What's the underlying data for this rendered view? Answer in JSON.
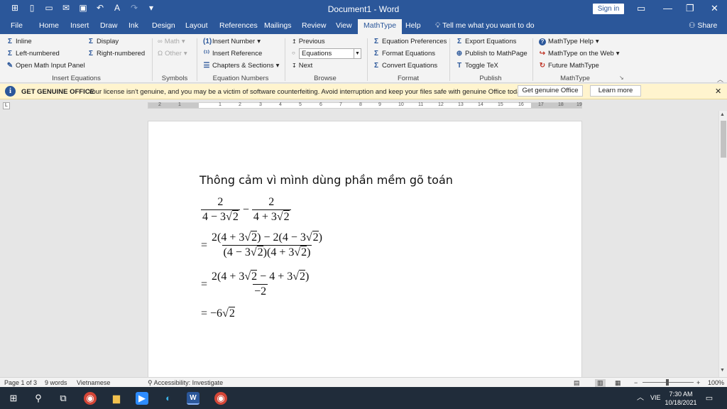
{
  "window": {
    "title": "Document1 - Word",
    "sign_in": "Sign in"
  },
  "icons": {
    "autosave": "autosave-icon",
    "new": "new-document-icon",
    "open": "open-folder-icon",
    "save": "save-icon",
    "undo": "undo-icon",
    "redo": "redo-icon",
    "customize": "customize-qat-icon",
    "ribbon_display": "ribbon-display-icon",
    "minimize": "minimize-icon",
    "restore": "restore-icon",
    "close": "close-icon",
    "tell_me": "lightbulb-icon",
    "share": "person-icon",
    "info": "info-icon"
  },
  "tabs": [
    "File",
    "Home",
    "Insert",
    "Draw",
    "Ink",
    "Design",
    "Layout",
    "References",
    "Mailings",
    "Review",
    "View",
    "MathType",
    "Help"
  ],
  "active_tab": "MathType",
  "tell_me": "Tell me what you want to do",
  "share": "Share",
  "ribbon": {
    "insert_equations": {
      "label": "Insert Equations",
      "inline": "Inline",
      "display": "Display",
      "left_numbered": "Left-numbered",
      "right_numbered": "Right-numbered",
      "open_panel": "Open Math Input Panel"
    },
    "symbols": {
      "label": "Symbols",
      "math": "Math",
      "other": "Other"
    },
    "equation_numbers": {
      "label": "Equation Numbers",
      "insert_number": "Insert Number",
      "insert_reference": "Insert Reference",
      "chapters_sections": "Chapters & Sections"
    },
    "browse": {
      "label": "Browse",
      "previous": "Previous",
      "combo_value": "Equations",
      "next": "Next"
    },
    "format": {
      "label": "Format",
      "preferences": "Equation Preferences",
      "format_equations": "Format Equations",
      "convert_equations": "Convert Equations"
    },
    "publish": {
      "label": "Publish",
      "export": "Export Equations",
      "publish_mathpage": "Publish to MathPage",
      "toggle_tex": "Toggle TeX"
    },
    "mathtype": {
      "label": "MathType",
      "help": "MathType Help",
      "web": "MathType on the Web",
      "future": "Future MathType"
    }
  },
  "message_bar": {
    "title": "GET GENUINE OFFICE",
    "text": "Your license isn't genuine, and you may be a victim of software counterfeiting. Avoid interruption and keep your files safe with genuine Office today.",
    "primary_button": "Get genuine Office",
    "secondary_button": "Learn more"
  },
  "ruler": {
    "numbers": [
      "2",
      "1",
      "1",
      "2",
      "3",
      "4",
      "5",
      "6",
      "7",
      "8",
      "9",
      "10",
      "11",
      "12",
      "13",
      "14",
      "15",
      "16",
      "17",
      "18",
      "19"
    ]
  },
  "document": {
    "text_line": "Thông cảm vì mình dùng phần mềm gõ toán",
    "eq1": {
      "num_a": "2",
      "den_a_pre": "4 − 3",
      "den_a_rad": "2",
      "op": "−",
      "num_b": "2",
      "den_b_pre": "4 + 3",
      "den_b_rad": "2"
    },
    "eq2": {
      "eq": "=",
      "num_p1": "2(4 + 3",
      "num_r1": "2",
      "num_p2": ") − 2(4 − 3",
      "num_r2": "2",
      "num_p3": ")",
      "den_p1": "(4 − 3",
      "den_r1": "2",
      "den_p2": ")(4 + 3",
      "den_r2": "2",
      "den_p3": ")"
    },
    "eq3": {
      "eq": "=",
      "num_p1": "2(4 + 3",
      "num_r1": "2",
      "num_p2": " − 4 + 3",
      "num_r2": "2",
      "num_p3": ")",
      "den": "−2"
    },
    "eq4": {
      "eq": "=",
      "pre": "−6",
      "rad": "2"
    }
  },
  "status": {
    "page": "Page 1 of 3",
    "words": "9 words",
    "language": "Vietnamese",
    "accessibility": "Accessibility: Investigate",
    "zoom": "100%"
  },
  "taskbar": {
    "lang": "VIE",
    "time": "7:30 AM",
    "date": "10/18/2021"
  }
}
